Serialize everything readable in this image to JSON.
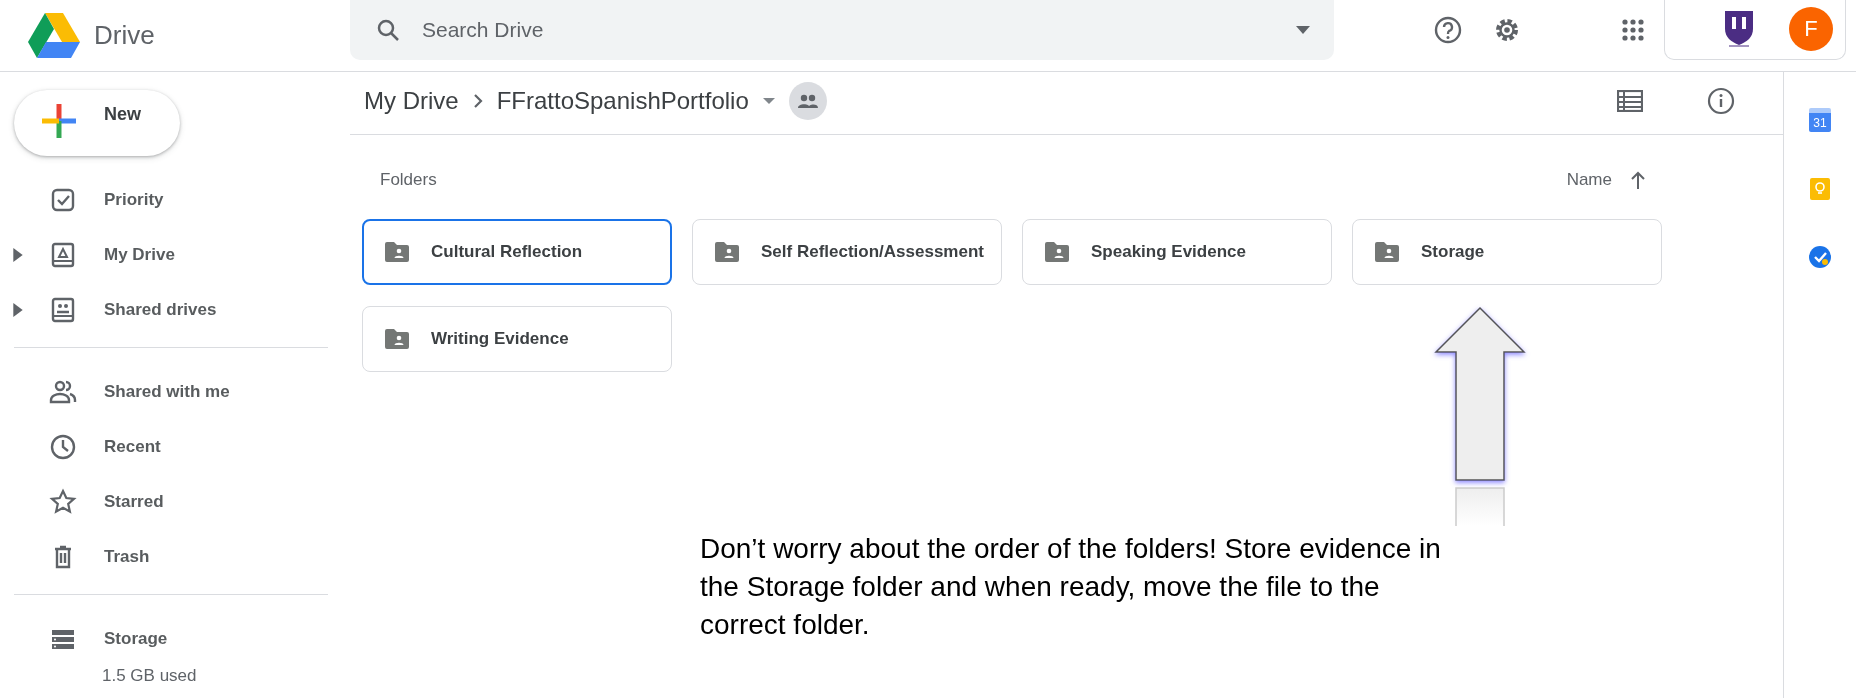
{
  "app": {
    "name": "Drive"
  },
  "search": {
    "placeholder": "Search Drive"
  },
  "account": {
    "initial": "F"
  },
  "new_button": {
    "label": "New"
  },
  "sidebar": {
    "sections": [
      {
        "items": [
          {
            "label": "Priority",
            "expandable": false
          },
          {
            "label": "My Drive",
            "expandable": true
          },
          {
            "label": "Shared drives",
            "expandable": true
          }
        ]
      },
      {
        "items": [
          {
            "label": "Shared with me",
            "expandable": false
          },
          {
            "label": "Recent",
            "expandable": false
          },
          {
            "label": "Starred",
            "expandable": false
          },
          {
            "label": "Trash",
            "expandable": false
          }
        ]
      },
      {
        "items": [
          {
            "label": "Storage",
            "expandable": false,
            "detail": "1.5 GB used"
          }
        ]
      }
    ]
  },
  "breadcrumb": [
    {
      "label": "My Drive"
    },
    {
      "label": "FFrattoSpanishPortfolio"
    }
  ],
  "folders": {
    "heading": "Folders",
    "sort_label": "Name",
    "items": [
      {
        "name": "Cultural Reflection",
        "selected": true
      },
      {
        "name": "Self Reflection/Assessment",
        "selected": false
      },
      {
        "name": "Speaking Evidence",
        "selected": false
      },
      {
        "name": "Storage",
        "selected": false
      },
      {
        "name": "Writing Evidence",
        "selected": false
      }
    ]
  },
  "side_panel": {
    "calendar_day": "31"
  },
  "annotation": {
    "note": "Don’t worry about the order of the folders! Store evidence in the Storage folder and when ready, move the file to the correct folder."
  }
}
